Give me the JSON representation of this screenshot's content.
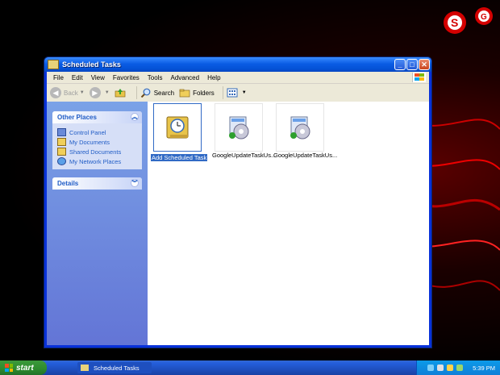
{
  "window": {
    "title": "Scheduled Tasks"
  },
  "menu": [
    "File",
    "Edit",
    "View",
    "Favorites",
    "Tools",
    "Advanced",
    "Help"
  ],
  "toolbar": {
    "back": "Back",
    "search": "Search",
    "folders": "Folders"
  },
  "left_pane": {
    "other_places": {
      "title": "Other Places",
      "links": [
        "Control Panel",
        "My Documents",
        "Shared Documents",
        "My Network Places"
      ]
    },
    "details": {
      "title": "Details"
    }
  },
  "items": [
    {
      "label": "Add Scheduled Task",
      "selected": true
    },
    {
      "label": "GoogleUpdateTaskUs...",
      "selected": false
    },
    {
      "label": "GoogleUpdateTaskUs...",
      "selected": false
    }
  ],
  "taskbar": {
    "start": "start",
    "task_button": "Scheduled Tasks",
    "clock": "5:39 PM",
    "help": "?"
  },
  "colors": {
    "accent_red": "#d40000",
    "xp_blue": "#0831d9",
    "selection": "#316ac5"
  }
}
